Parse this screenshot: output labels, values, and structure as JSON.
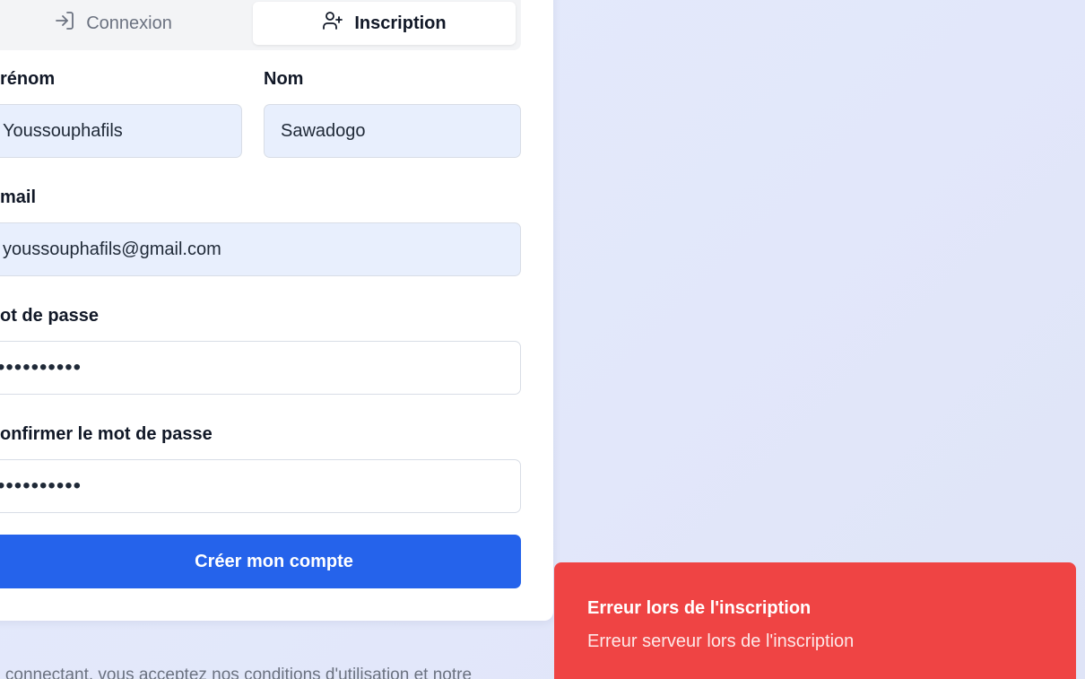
{
  "tabs": {
    "login_label": "Connexion",
    "register_label": "Inscription"
  },
  "form": {
    "firstname_label": "rénom",
    "firstname_value": "Youssouphafils",
    "lastname_label": "Nom",
    "lastname_value": "Sawadogo",
    "email_label": "mail",
    "email_value": "youssouphafils@gmail.com",
    "password_label": "ot de passe",
    "password_value": "••••••••••",
    "confirm_label": "onfirmer le mot de passe",
    "confirm_value": "••••••••••",
    "submit_label": "Créer mon compte"
  },
  "footer": {
    "terms_text": "ous connectant, vous acceptez nos conditions d'utilisation et notre"
  },
  "toast": {
    "title": "Erreur lors de l'inscription",
    "description": "Erreur serveur lors de l'inscription"
  },
  "colors": {
    "primary": "#2563eb",
    "error": "#ef4444",
    "input_filled_bg": "#e8effd"
  },
  "icons": {
    "login_tab": "log-in-icon",
    "register_tab": "user-plus-icon"
  }
}
